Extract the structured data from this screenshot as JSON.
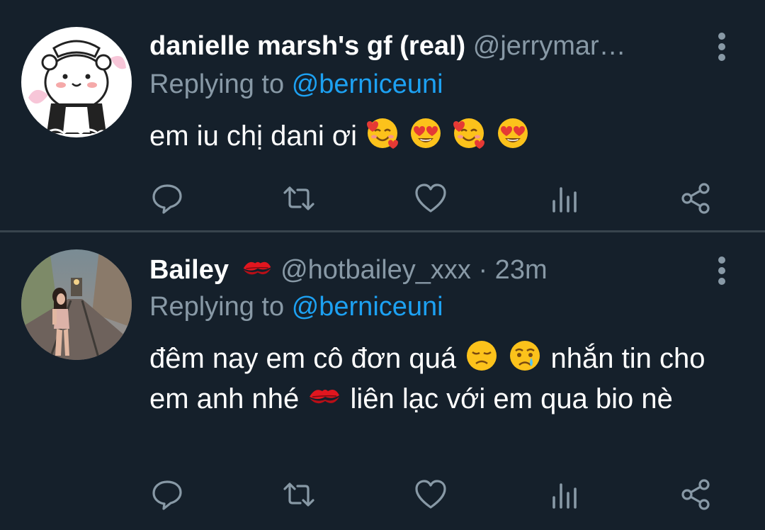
{
  "tweets": [
    {
      "display_name": "danielle marsh's gf (real)",
      "handle": "@jerrymar…",
      "replying_prefix": "Replying to",
      "replying_to": "@berniceuni",
      "body_text": "em iu chị dani ơi",
      "body_emojis": [
        "smiling-face-with-hearts",
        "heart-eyes",
        "smiling-face-with-hearts",
        "heart-eyes"
      ]
    },
    {
      "display_name": "Bailey",
      "name_emoji": "kiss-mark",
      "handle": "@hotbailey_xxx · 23m",
      "replying_prefix": "Replying to",
      "replying_to": "@berniceuni",
      "body_part1": "đêm nay em cô đơn quá",
      "body_emojis_1": [
        "disappointed-face",
        "crying-face"
      ],
      "body_part2": "nhắn tin cho em anh nhé",
      "body_emoji_2": "kiss-mark",
      "body_part3": "liên lạc với em qua bio nè"
    }
  ],
  "actions": [
    "reply",
    "retweet",
    "like",
    "analytics",
    "share"
  ],
  "colors": {
    "background": "#15202b",
    "muted": "#8899a6",
    "link": "#1da1f2",
    "divider": "#38444d"
  }
}
